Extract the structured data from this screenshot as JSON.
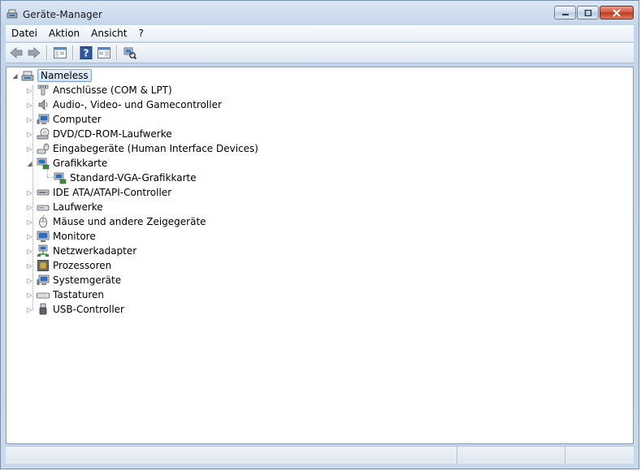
{
  "window": {
    "title": "Geräte-Manager"
  },
  "menu": [
    {
      "label": "Datei"
    },
    {
      "label": "Aktion"
    },
    {
      "label": "Ansicht"
    },
    {
      "label": "?"
    }
  ],
  "toolbar": {
    "buttons": [
      {
        "icon": "back-arrow-icon"
      },
      {
        "icon": "forward-arrow-icon"
      },
      {
        "icon": "show-hide-console-tree-icon"
      },
      {
        "icon": "help-icon"
      },
      {
        "icon": "properties-icon"
      },
      {
        "icon": "scan-hardware-icon"
      }
    ]
  },
  "tree": {
    "root": {
      "label": "Nameless",
      "icon": "computer-root-icon",
      "expanded": true
    },
    "categories": [
      {
        "label": "Anschlüsse (COM & LPT)",
        "icon": "port-icon",
        "expanded": false
      },
      {
        "label": "Audio-, Video- und Gamecontroller",
        "icon": "speaker-icon",
        "expanded": false
      },
      {
        "label": "Computer",
        "icon": "computer-icon",
        "expanded": false
      },
      {
        "label": "DVD/CD-ROM-Laufwerke",
        "icon": "dvd-drive-icon",
        "expanded": false
      },
      {
        "label": "Eingabegeräte (Human Interface Devices)",
        "icon": "hid-icon",
        "expanded": false
      },
      {
        "label": "Grafikkarte",
        "icon": "display-adapter-icon",
        "expanded": true,
        "children": [
          {
            "label": "Standard-VGA-Grafikkarte",
            "icon": "display-adapter-icon"
          }
        ]
      },
      {
        "label": "IDE ATA/ATAPI-Controller",
        "icon": "ide-controller-icon",
        "expanded": false
      },
      {
        "label": "Laufwerke",
        "icon": "disk-drive-icon",
        "expanded": false
      },
      {
        "label": "Mäuse und andere Zeigegeräte",
        "icon": "mouse-icon",
        "expanded": false
      },
      {
        "label": "Monitore",
        "icon": "monitor-icon",
        "expanded": false
      },
      {
        "label": "Netzwerkadapter",
        "icon": "network-adapter-icon",
        "expanded": false
      },
      {
        "label": "Prozessoren",
        "icon": "processor-icon",
        "expanded": false
      },
      {
        "label": "Systemgeräte",
        "icon": "system-device-icon",
        "expanded": false
      },
      {
        "label": "Tastaturen",
        "icon": "keyboard-icon",
        "expanded": false
      },
      {
        "label": "USB-Controller",
        "icon": "usb-icon",
        "expanded": false
      }
    ]
  }
}
